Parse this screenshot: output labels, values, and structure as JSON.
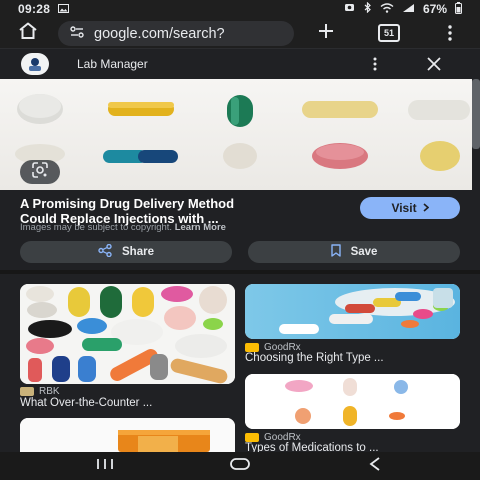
{
  "status": {
    "time": "09:28",
    "battery": "67%"
  },
  "browser": {
    "url": "google.com/search?",
    "tab_count": "51"
  },
  "viewer": {
    "site_name": "Lab Manager",
    "title_line1": "A Promising Drug Delivery Method",
    "title_line2": "Could Replace Injections with ...",
    "visit_label": "Visit",
    "copyright_text": "Images may be subject to copyright.",
    "learn_more": "Learn More",
    "share_label": "Share",
    "save_label": "Save"
  },
  "related": [
    {
      "source": "RBK",
      "title": "What Over-the-Counter ...",
      "logo_color": "#c9b27a"
    },
    {
      "source": "GoodRx",
      "title": "Choosing the Right Type ...",
      "logo_color": "#fbbc04"
    },
    {
      "source": "GoodRx",
      "title": "Types of Medications to ...",
      "logo_color": "#fbbc04"
    }
  ],
  "icons": {
    "home": "home-icon",
    "site_info": "site-info-icon",
    "new_tab": "plus-icon",
    "tabs": "tab-switcher-icon",
    "menu": "more-vert-icon",
    "close": "close-icon",
    "lens": "lens-icon",
    "share": "share-icon",
    "save": "bookmark-icon"
  },
  "colors": {
    "accent": "#8ab4f8",
    "background": "#202124"
  }
}
